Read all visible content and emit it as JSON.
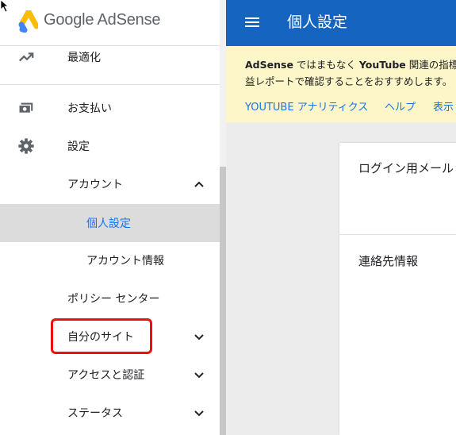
{
  "app": {
    "logo_text": "Google AdSense"
  },
  "sidebar": {
    "items": [
      {
        "label": "最適化",
        "icon": "trending-up-icon"
      },
      {
        "label": "お支払い",
        "icon": "payments-icon"
      },
      {
        "label": "設定",
        "icon": "gear-icon"
      },
      {
        "label": "アカウント",
        "expanded": true
      },
      {
        "label": "個人設定",
        "active": true
      },
      {
        "label": "アカウント情報"
      },
      {
        "label": "ポリシー センター"
      },
      {
        "label": "自分のサイト",
        "expanded": false,
        "highlighted": true
      },
      {
        "label": "アクセスと認証",
        "expanded": false
      },
      {
        "label": "ステータス",
        "expanded": false
      }
    ]
  },
  "header": {
    "title": "個人設定"
  },
  "banner": {
    "line1_brand": "AdSense",
    "line1_text1": " ではまもなく ",
    "line1_strong": "YouTube",
    "line1_text2": " 関連の指標デ",
    "line2": "益レポートで確認することをおすすめします。",
    "links": [
      "YOUTUBE アナリティクス",
      "ヘルプ",
      "表示"
    ]
  },
  "card": {
    "rows": [
      "ログイン用メール",
      "連絡先情報"
    ]
  },
  "colors": {
    "appbar": "#1565c0",
    "link": "#1a73e8",
    "banner": "#fdf6c8",
    "highlight": "#ee1010",
    "active_row": "#dcdcdc"
  }
}
